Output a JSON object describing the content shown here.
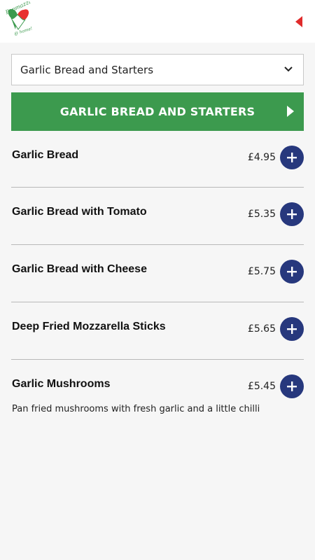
{
  "header": {
    "logo_text_1": "Papmazzi",
    "logo_text_2": "@ home!",
    "back_icon": "chevron-left-icon"
  },
  "category_select": {
    "selected": "Garlic Bread and Starters",
    "icon": "chevron-down-icon"
  },
  "category_heading": {
    "label": "GARLIC BREAD AND STARTERS",
    "icon": "play-right-icon"
  },
  "colors": {
    "accent_green": "#3c9a4e",
    "add_button_blue": "#27387d",
    "back_red": "#e02b2b"
  },
  "items": [
    {
      "name": "Garlic Bread",
      "price": "£4.95",
      "description": ""
    },
    {
      "name": "Garlic Bread with Tomato",
      "price": "£5.35",
      "description": ""
    },
    {
      "name": "Garlic Bread with Cheese",
      "price": "£5.75",
      "description": ""
    },
    {
      "name": "Deep Fried Mozzarella Sticks",
      "price": "£5.65",
      "description": ""
    },
    {
      "name": "Garlic Mushrooms",
      "price": "£5.45",
      "description": "Pan fried mushrooms with fresh garlic and a little chilli"
    }
  ]
}
